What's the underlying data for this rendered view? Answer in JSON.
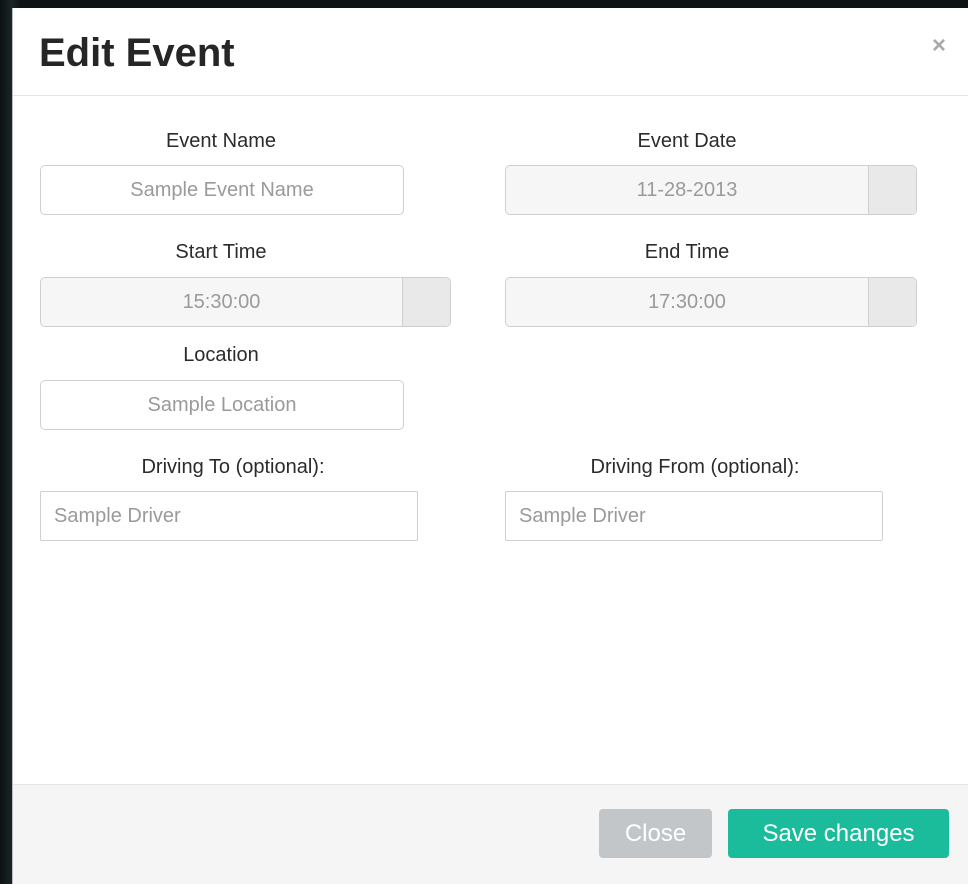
{
  "modal": {
    "title": "Edit Event",
    "close_symbol": "×"
  },
  "form": {
    "event_name": {
      "label": "Event Name",
      "placeholder": "Sample Event Name",
      "value": ""
    },
    "event_date": {
      "label": "Event Date",
      "value": "11-28-2013",
      "addon_icon": "calendar-icon"
    },
    "start_time": {
      "label": "Start Time",
      "value": "15:30:00",
      "addon_icon": "clock-icon"
    },
    "end_time": {
      "label": "End Time",
      "value": "17:30:00",
      "addon_icon": "clock-icon"
    },
    "location": {
      "label": "Location",
      "placeholder": "Sample Location",
      "value": ""
    },
    "driving_to": {
      "label": "Driving To (optional):",
      "placeholder": "Sample Driver",
      "value": ""
    },
    "driving_from": {
      "label": "Driving From (optional):",
      "placeholder": "Sample Driver",
      "value": ""
    }
  },
  "footer": {
    "close_label": "Close",
    "save_label": "Save changes"
  },
  "colors": {
    "save_button": "#1abc9c",
    "close_button": "#c2c6c9"
  }
}
